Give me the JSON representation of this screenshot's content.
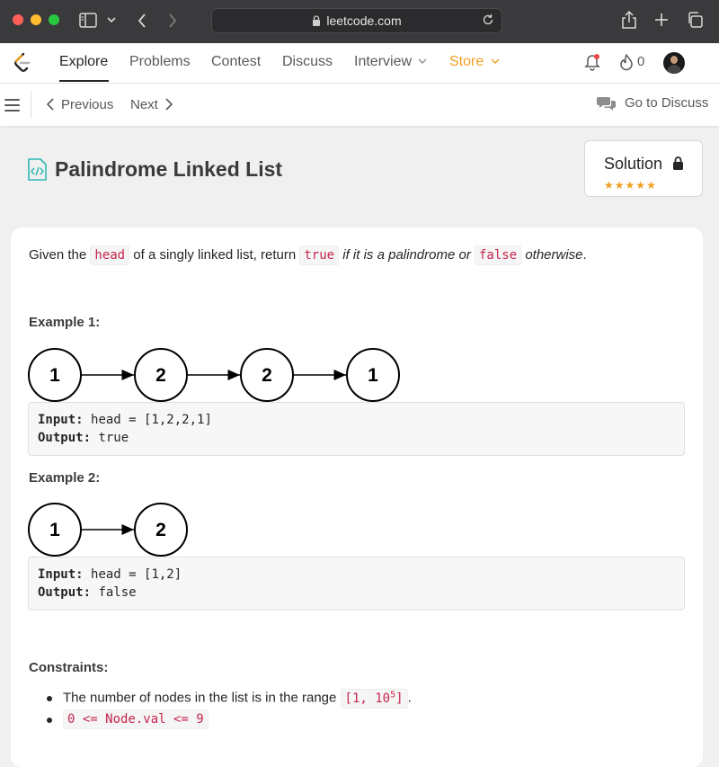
{
  "browser": {
    "url": "leetcode.com"
  },
  "nav": {
    "items": [
      "Explore",
      "Problems",
      "Contest",
      "Discuss",
      "Interview",
      "Store"
    ],
    "streak_count": "0"
  },
  "subbar": {
    "previous": "Previous",
    "next": "Next",
    "go_to_discuss": "Go to Discuss"
  },
  "problem": {
    "title": "Palindrome Linked List",
    "solution_label": "Solution",
    "solution_rating_stars": 5,
    "desc_parts": [
      "Given the",
      "head",
      "of a singly linked list, return",
      "true",
      "if it is a palindrome or",
      "false",
      "otherwise",
      "."
    ],
    "examples": [
      {
        "heading": "Example 1:",
        "nodes": [
          "1",
          "2",
          "2",
          "1"
        ],
        "input_label": "Input:",
        "input_value": "head = [1,2,2,1]",
        "output_label": "Output:",
        "output_value": "true"
      },
      {
        "heading": "Example 2:",
        "nodes": [
          "1",
          "2"
        ],
        "input_label": "Input:",
        "input_value": "head = [1,2]",
        "output_label": "Output:",
        "output_value": "false"
      }
    ],
    "constraints_heading": "Constraints:",
    "constraint1_text": "The number of nodes in the list is in the range",
    "constraint1_code_a": "[1, 10",
    "constraint1_code_sup": "5",
    "constraint1_code_b": "]",
    "constraint1_end": ".",
    "constraint2_code": "0 <= Node.val <= 9"
  }
}
